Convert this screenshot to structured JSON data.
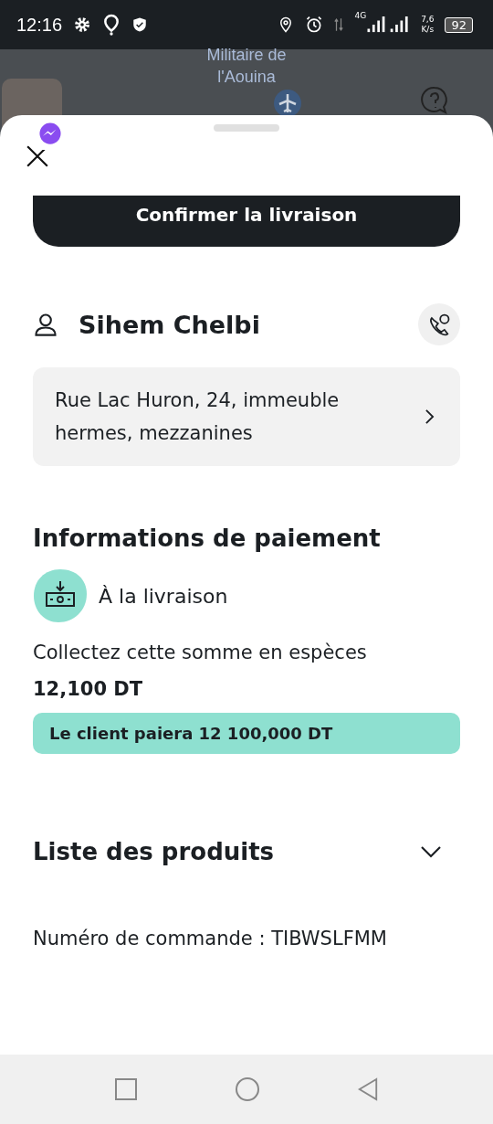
{
  "status_bar": {
    "time": "12:16",
    "network": "4G",
    "speed_value": "7,6",
    "speed_unit": "K/s",
    "battery": "92"
  },
  "map": {
    "label_lines": [
      "Militaire de",
      "l'Aouina"
    ]
  },
  "sheet": {
    "confirm_button": "Confirmer la livraison",
    "customer": {
      "name": "Sihem Chelbi",
      "address": "Rue Lac Huron, 24, immeuble hermes, mezzanines"
    },
    "payment": {
      "heading": "Informations de paiement",
      "method": "À la livraison",
      "instruction": "Collectez cette somme en espèces",
      "amount": "12,100 DT",
      "banner": "Le client paiera 12 100,000 DT"
    },
    "products": {
      "heading": "Liste des produits",
      "expanded": false
    },
    "order_number": "Numéro de commande : TIBWSLFMM"
  }
}
